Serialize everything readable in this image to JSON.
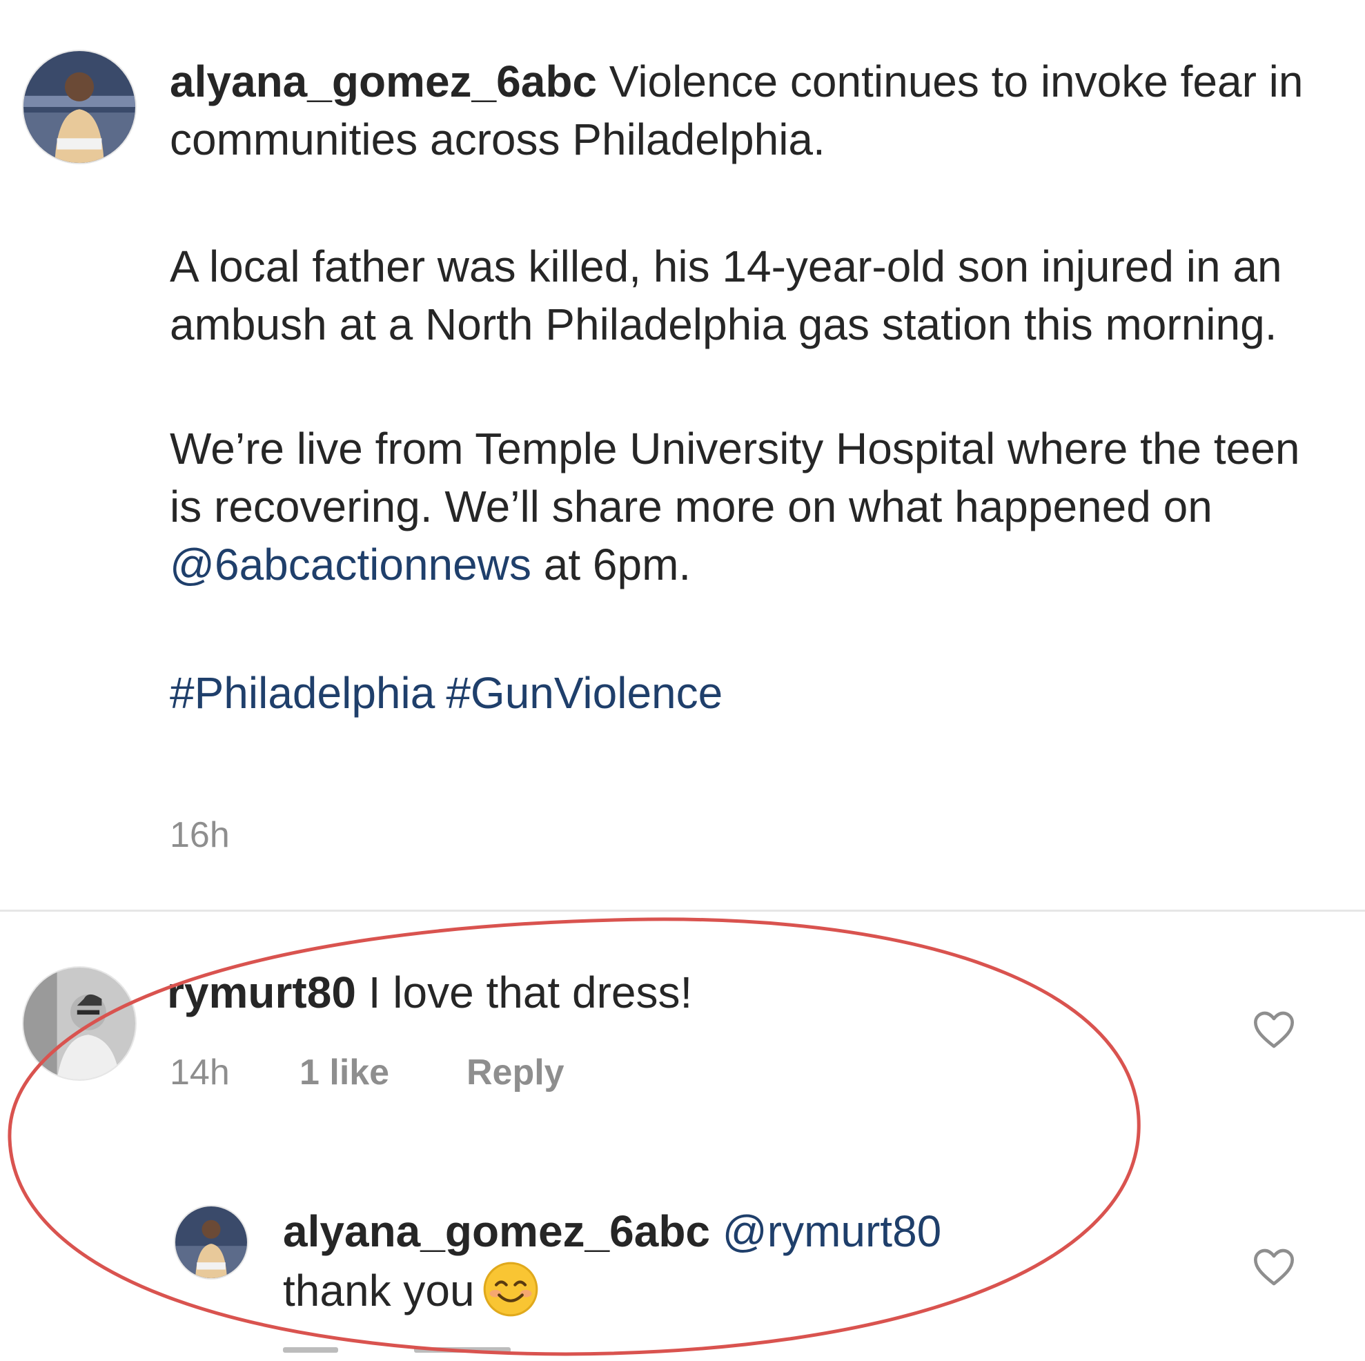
{
  "post": {
    "author": "alyana_gomez_6abc",
    "caption_intro": " Violence continues to invoke fear in communities across Philadelphia.",
    "caption_para2": "A local father was killed, his 14-year-old son injured in an ambush at a North Philadelphia gas station this morning.",
    "caption_para3_start": "We’re live from Temple University Hospital where the teen is recovering. We’ll share more on what happened on ",
    "caption_para3_mention": "@6abcactionnews",
    "caption_para3_end": " at 6pm.",
    "hashtags": [
      "#Philadelphia",
      "#GunViolence"
    ],
    "time": "16h"
  },
  "comment": {
    "author": "rymurt80",
    "text": " I love that dress!",
    "time": "14h",
    "likes": "1 like",
    "reply_label": "Reply"
  },
  "reply": {
    "author": "alyana_gomez_6abc",
    "mention": "@rymurt80",
    "text": "thank you"
  },
  "colors": {
    "link": "#1f3f6b",
    "meta": "#8e8e8e",
    "highlight": "#d9534f"
  },
  "icons": {
    "like": "heart-outline-icon",
    "emoji": "smiling-face-emoji"
  }
}
